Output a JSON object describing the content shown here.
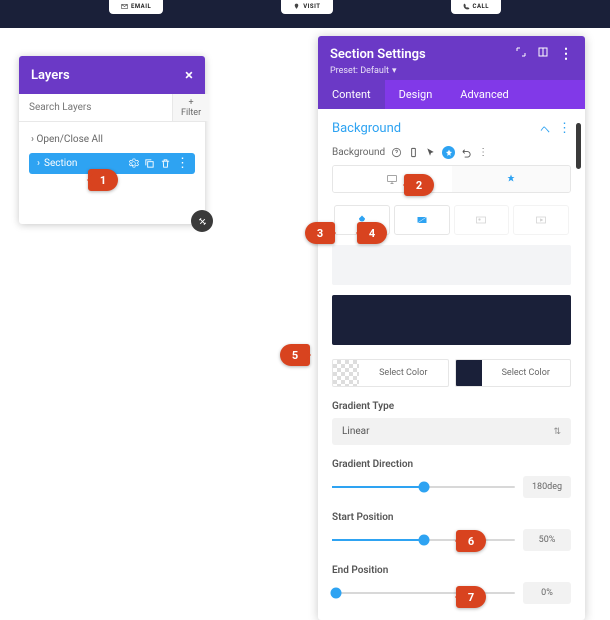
{
  "topbar": {
    "email": "EMAIL",
    "visit": "VISIT",
    "call": "CALL"
  },
  "layers": {
    "title": "Layers",
    "search_placeholder": "Search Layers",
    "filter": "+ Filter",
    "open_close": "Open/Close All",
    "section_label": "Section"
  },
  "settings": {
    "title": "Section Settings",
    "preset": "Preset: Default",
    "tabs": {
      "content": "Content",
      "design": "Design",
      "advanced": "Advanced"
    },
    "bg_heading": "Background",
    "bg_label": "Background",
    "gradient_type_label": "Gradient Type",
    "gradient_type_value": "Linear",
    "gradient_dir_label": "Gradient Direction",
    "gradient_dir_value": "180deg",
    "start_pos_label": "Start Position",
    "start_pos_value": "50%",
    "end_pos_label": "End Position",
    "end_pos_value": "0%",
    "select_color": "Select Color"
  },
  "callouts": {
    "c1": "1",
    "c2": "2",
    "c3": "3",
    "c4": "4",
    "c5": "5",
    "c6": "6",
    "c7": "7"
  }
}
